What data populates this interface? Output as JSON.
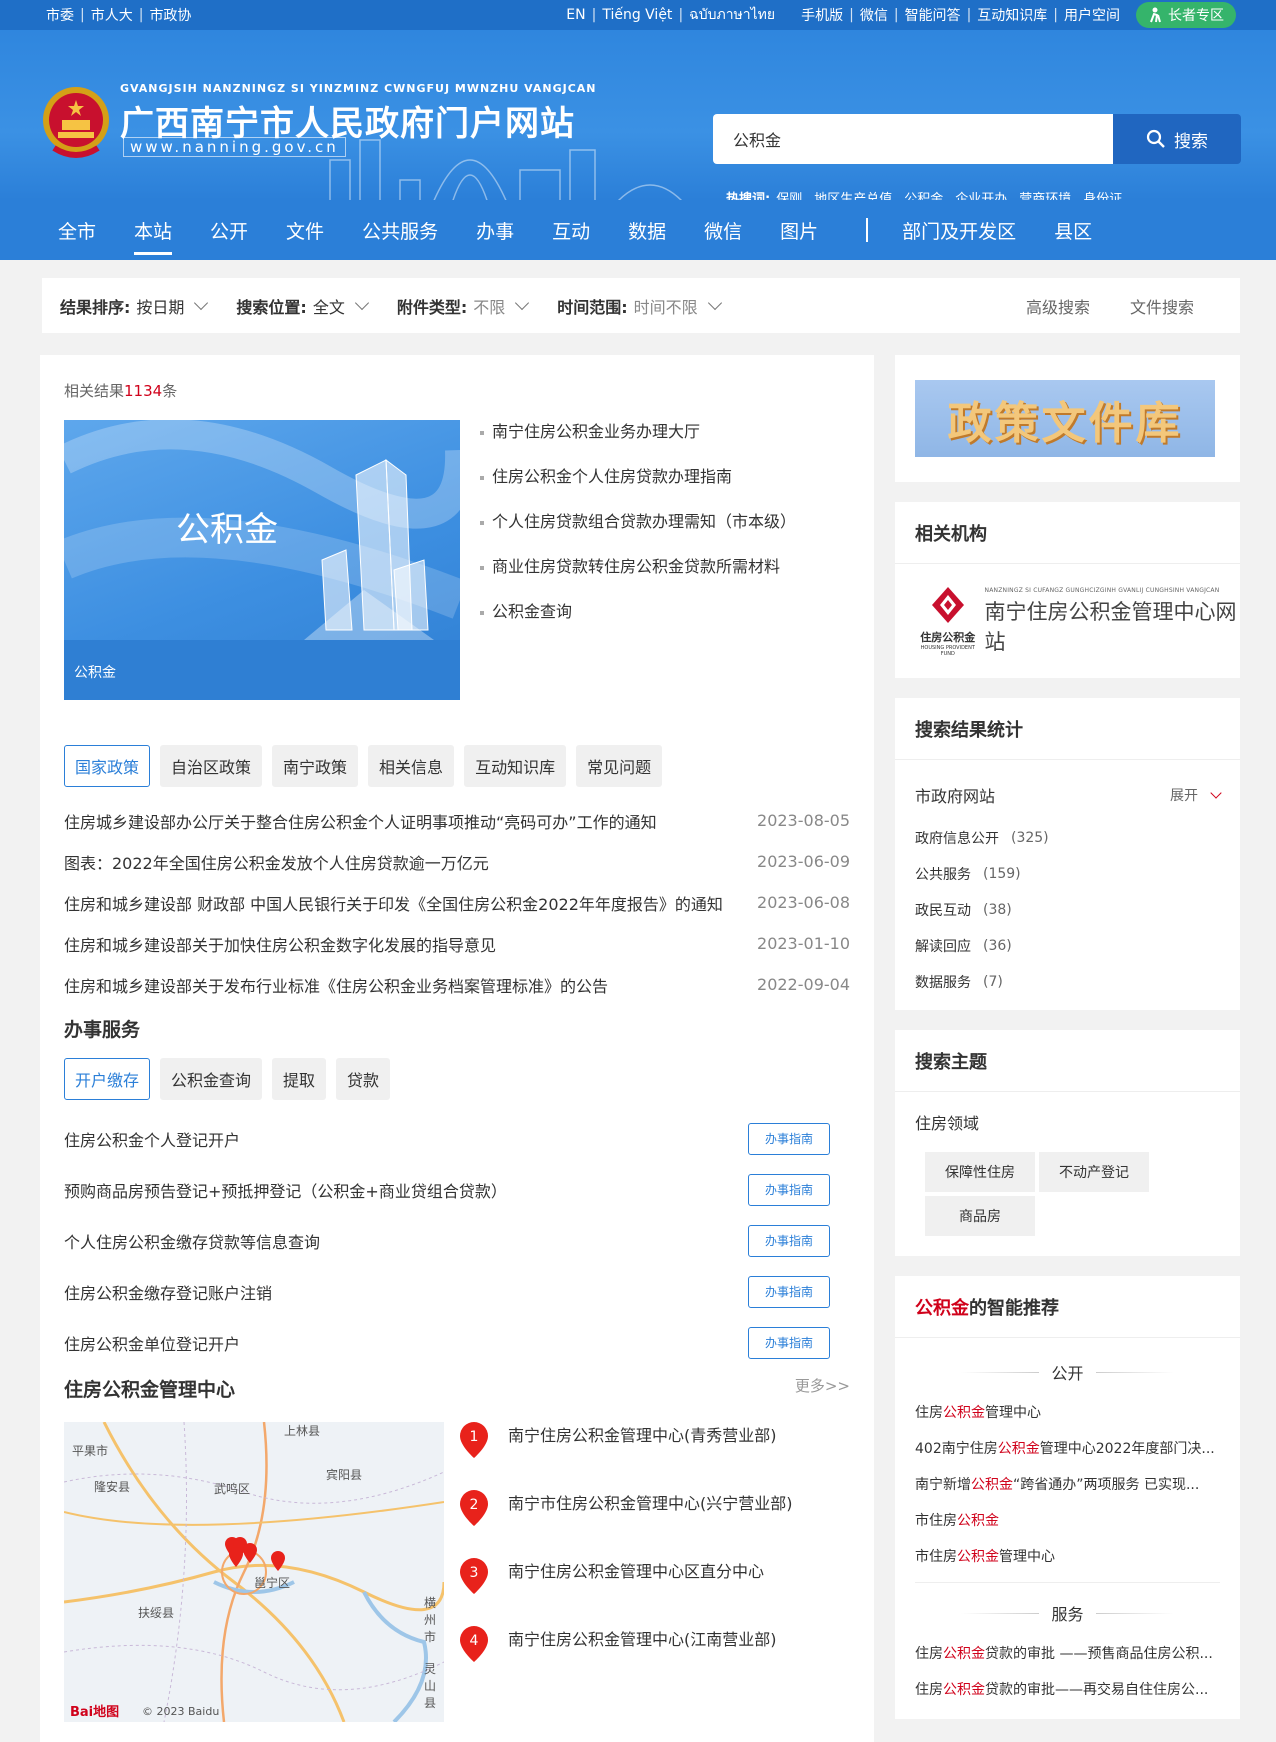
{
  "topbar": {
    "left": [
      "市委",
      "市人大",
      "市政协"
    ],
    "right": [
      "EN",
      "Tiếng Việt",
      "ฉบับภาษาไทย",
      "手机版",
      "微信",
      "智能问答",
      "互动知识库",
      "用户空间"
    ],
    "elder": "长者专区"
  },
  "header": {
    "pinyin": "GVANGJSIH NANZNINGZ SI YINZMINZ CWNGFUJ MWNZHU VANGJCAN",
    "title": "广西南宁市人民政府门户网站",
    "url": "www.nanning.gov.cn",
    "search_value": "公积金",
    "search_button": "搜索",
    "hot_label": "热搜词:",
    "hot_words": [
      "保刚",
      "地区生产总值",
      "公积金",
      "企业开办",
      "营商环境",
      "身份证"
    ]
  },
  "nav": {
    "items": [
      "全市",
      "本站",
      "公开",
      "文件",
      "公共服务",
      "办事",
      "互动",
      "数据",
      "微信",
      "图片"
    ],
    "items_right": [
      "部门及开发区",
      "县区"
    ],
    "active": "本站"
  },
  "filter": {
    "sort_label": "结果排序:",
    "sort_value": "按日期",
    "pos_label": "搜索位置:",
    "pos_value": "全文",
    "att_label": "附件类型:",
    "att_value": "不限",
    "time_label": "时间范围:",
    "time_value": "时间不限",
    "advanced": "高级搜索",
    "file_search": "文件搜索"
  },
  "results": {
    "count_prefix": "相关结果",
    "count": "1134",
    "count_suffix": "条",
    "banner_title": "公积金",
    "banner_caption": "公积金",
    "quick_links": [
      "南宁住房公积金业务办理大厅",
      "住房公积金个人住房贷款办理指南",
      "个人住房贷款组合贷款办理需知（市本级）",
      "商业住房贷款转住房公积金贷款所需材料",
      "公积金查询"
    ],
    "policy_tabs": [
      "国家政策",
      "自治区政策",
      "南宁政策",
      "相关信息",
      "互动知识库",
      "常见问题"
    ],
    "policies": [
      {
        "title": "住房城乡建设部办公厅关于整合住房公积金个人证明事项推动“亮码可办”工作的通知",
        "date": "2023-08-05"
      },
      {
        "title": "图表：2022年全国住房公积金发放个人住房贷款逾一万亿元",
        "date": "2023-06-09"
      },
      {
        "title": "住房和城乡建设部 财政部 中国人民银行关于印发《全国住房公积金2022年年度报告》的通知",
        "date": "2023-06-08"
      },
      {
        "title": "住房和城乡建设部关于加快住房公积金数字化发展的指导意见",
        "date": "2023-01-10"
      },
      {
        "title": "住房和城乡建设部关于发布行业标准《住房公积金业务档案管理标准》的公告",
        "date": "2022-09-04"
      }
    ],
    "service_title": "办事服务",
    "service_tabs": [
      "开户缴存",
      "公积金查询",
      "提取",
      "贷款"
    ],
    "services": [
      "住房公积金个人登记开户",
      "预购商品房预告登记+预抵押登记（公积金+商业贷组合贷款）",
      "个人住房公积金缴存贷款等信息查询",
      "住房公积金缴存登记账户注销",
      "住房公积金单位登记开户"
    ],
    "guide_label": "办事指南",
    "center_title": "住房公积金管理中心",
    "more": "更多>>",
    "map_labels": [
      "上林县",
      "平果市",
      "隆安县",
      "武鸣区",
      "宾阳县",
      "邕宁区",
      "扶绥县",
      "横州市",
      "灵山县"
    ],
    "map_copyright": "© 2023 Baidu",
    "map_logo": "Bai地图",
    "centers": [
      {
        "num": "1",
        "name": "南宁住房公积金管理中心(青秀营业部)"
      },
      {
        "num": "2",
        "name": "南宁市住房公积金管理中心(兴宁营业部)"
      },
      {
        "num": "3",
        "name": "南宁住房公积金管理中心区直分中心"
      },
      {
        "num": "4",
        "name": "南宁住房公积金管理中心(江南营业部)"
      }
    ]
  },
  "sidebar": {
    "policy_lib": "政策文件库",
    "org_title": "相关机构",
    "org_pinyin": "NANZNINGZ SI CUFANGZ GUNGHCIZGINH GVANLIJ CUNGHSINH VANGJCAN",
    "org_logo_text": "住房公积金",
    "org_logo_en": "HOUSING PROVIDENT FUND",
    "org_name": "南宁住房公积金管理中心网站",
    "stats_title": "搜索结果统计",
    "stats_site": "市政府网站",
    "stats_expand": "展开",
    "stats": [
      {
        "label": "政府信息公开",
        "count": "(325)"
      },
      {
        "label": "公共服务",
        "count": "(159)"
      },
      {
        "label": "政民互动",
        "count": "(38)"
      },
      {
        "label": "解读回应",
        "count": "(36)"
      },
      {
        "label": "数据服务",
        "count": "(7)"
      }
    ],
    "topic_title": "搜索主题",
    "topic_field": "住房领域",
    "topic_tags": [
      "保障性住房",
      "不动产登记",
      "商品房"
    ],
    "reco_hl": "公积金",
    "reco_title": "的智能推荐",
    "reco_group1": "公开",
    "reco_group1_items": [
      [
        "住房",
        "公积金",
        "管理中心"
      ],
      [
        "402南宁住房",
        "公积金",
        "管理中心2022年度部门决..."
      ],
      [
        "南宁新增",
        "公积金",
        "“跨省通办”两项服务 已实现..."
      ],
      [
        "市住房",
        "公积金",
        ""
      ],
      [
        "市住房",
        "公积金",
        "管理中心"
      ]
    ],
    "reco_group2": "服务",
    "reco_group2_items": [
      [
        "住房",
        "公积金",
        "贷款的审批 ——预售商品住房公积..."
      ],
      [
        "住房",
        "公积金",
        "贷款的审批——再交易自住住房公..."
      ]
    ]
  }
}
